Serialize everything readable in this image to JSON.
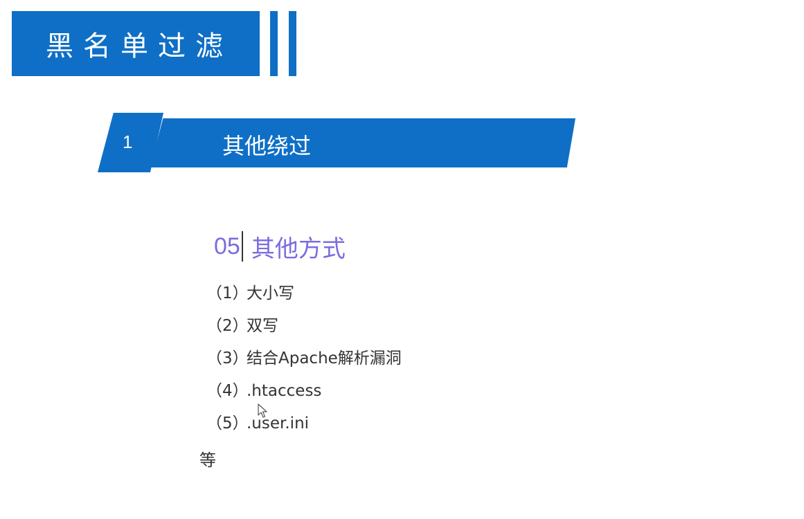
{
  "slide": {
    "title": "黑名单过滤",
    "section": {
      "number": "1",
      "title": "其他绕过"
    },
    "subheading": {
      "number": "05",
      "text": "其他方式"
    },
    "items": [
      {
        "marker": "（1）",
        "text": "大小写"
      },
      {
        "marker": "（2）",
        "text": "双写"
      },
      {
        "marker": "（3）",
        "text": "结合Apache解析漏洞"
      },
      {
        "marker": "（4）",
        "text": ".htaccess"
      },
      {
        "marker": "（5）",
        "text": ".user.ini"
      }
    ],
    "footer_text": "等"
  },
  "colors": {
    "brand_blue": "#0f6fc6",
    "subheading_purple": "#7b6ce0",
    "body_text": "#333333"
  },
  "icons": [
    "mouse-pointer-icon"
  ]
}
